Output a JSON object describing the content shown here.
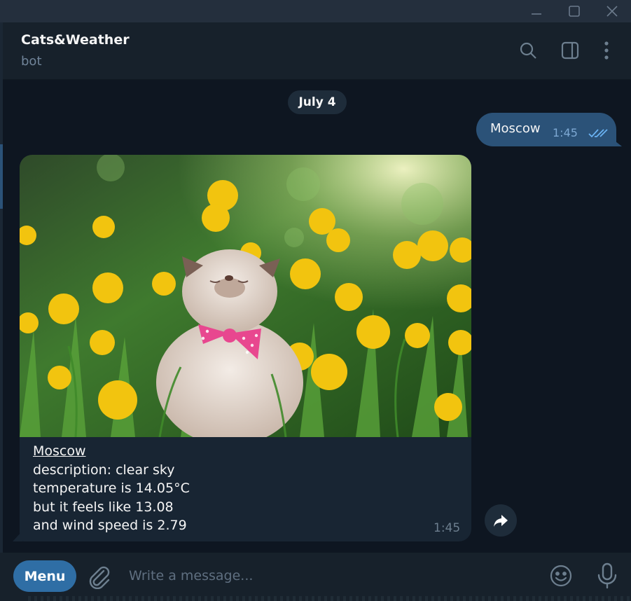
{
  "window": {
    "controls": [
      "minimize-icon",
      "maximize-icon",
      "close-icon"
    ]
  },
  "header": {
    "title": "Cats&Weather",
    "subtitle": "bot",
    "icons": [
      "search-icon",
      "sidebar-toggle-icon",
      "more-vertical-icon"
    ]
  },
  "chat": {
    "date_separator": "July 4",
    "outgoing": {
      "text": "Moscow",
      "time": "1:45",
      "status_icon": "double-check-icon"
    },
    "incoming": {
      "photo_alt": "kitten-photo",
      "city": "Moscow",
      "lines": [
        "description: clear sky",
        "temperature is 14.05°C",
        "but it feels like 13.08",
        "and wind speed is 2.79"
      ],
      "time": "1:45"
    }
  },
  "composer": {
    "menu_label": "Menu",
    "placeholder": "Write a message...",
    "icons": [
      "paperclip-icon",
      "emoji-icon",
      "microphone-icon"
    ]
  },
  "colors": {
    "background": "#0e1621",
    "header": "#17212b",
    "outgoing_bubble": "#2b5278",
    "incoming_bubble": "#182533",
    "accent": "#2f6ea5"
  }
}
